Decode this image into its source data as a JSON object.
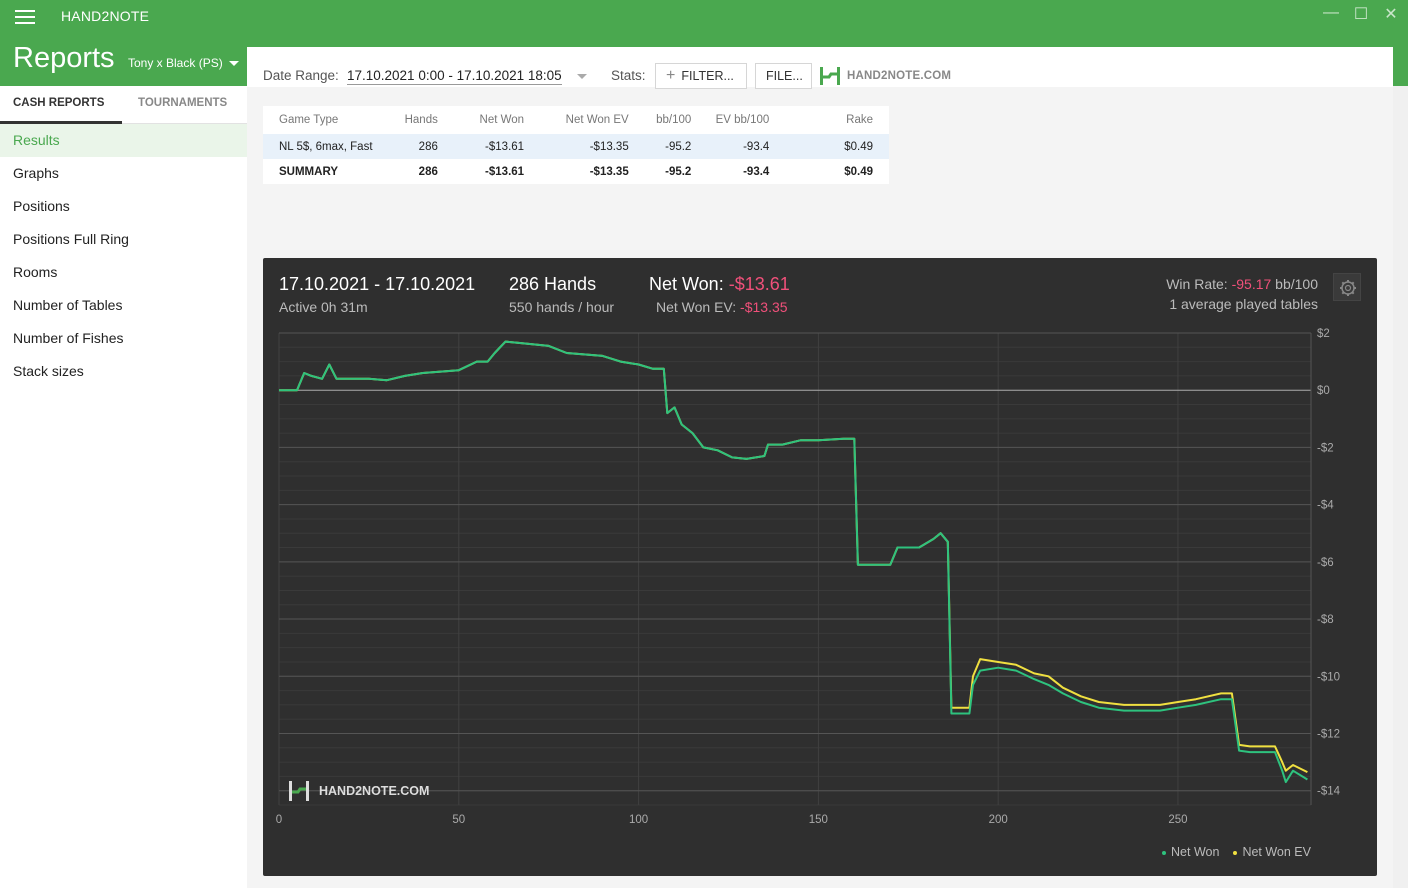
{
  "app": {
    "title": "HAND2NOTE",
    "window_controls": [
      "—",
      "☐",
      "✕"
    ]
  },
  "header": {
    "page_title": "Reports",
    "account": "Tony x Black (PS)"
  },
  "sidebar": {
    "tabs": [
      {
        "label": "CASH REPORTS",
        "active": true
      },
      {
        "label": "TOURNAMENTS",
        "active": false
      }
    ],
    "items": [
      {
        "label": "Results",
        "active": true
      },
      {
        "label": "Graphs",
        "active": false
      },
      {
        "label": "Positions",
        "active": false
      },
      {
        "label": "Positions Full Ring",
        "active": false
      },
      {
        "label": "Rooms",
        "active": false
      },
      {
        "label": "Number of Tables",
        "active": false
      },
      {
        "label": "Number of Fishes",
        "active": false
      },
      {
        "label": "Stack sizes",
        "active": false
      }
    ]
  },
  "toolbar": {
    "date_range_label": "Date Range:",
    "date_range_value": "17.10.2021 0:00 - 17.10.2021 18:05",
    "stats_label": "Stats:",
    "filter_label": "FILTER...",
    "file_label": "FILE...",
    "brand_text": "HAND2NOTE.COM"
  },
  "table": {
    "headers": [
      "Game Type",
      "Hands",
      "Net Won",
      "Net Won  EV",
      "bb/100",
      "EV bb/100",
      "Rake"
    ],
    "rows": [
      [
        "NL 5$, 6max, Fast",
        "286",
        "-$13.61",
        "-$13.35",
        "-95.2",
        "-93.4",
        "$0.49"
      ],
      [
        "SUMMARY",
        "286",
        "-$13.61",
        "-$13.35",
        "-95.2",
        "-93.4",
        "$0.49"
      ]
    ]
  },
  "chart_panel": {
    "date_range": "17.10.2021 - 17.10.2021",
    "active_time": "Active 0h 31m",
    "hands": "286 Hands",
    "hands_rate": "550 hands / hour",
    "net_won_label": "Net Won:",
    "net_won_value": "-$13.61",
    "net_won_ev_label": "Net Won  EV:",
    "net_won_ev_value": "-$13.35",
    "win_rate_label": "Win Rate:",
    "win_rate_value": "-95.17",
    "win_rate_unit": "bb/100",
    "avg_tables": "1 average played tables",
    "logo_text": "HAND2NOTE.COM"
  },
  "colors": {
    "accent": "#4aa84f",
    "net_won_line": "#2ec27e",
    "net_won_ev_line": "#f0e040",
    "negative": "#d9362b",
    "positive": "#3a9a3c",
    "pink": "#f0507a"
  },
  "chart_data": {
    "type": "line",
    "title": "",
    "xlabel": "",
    "ylabel": "",
    "xlim": [
      0,
      287
    ],
    "ylim": [
      -14.5,
      2
    ],
    "x_ticks": [
      0,
      50,
      100,
      150,
      200,
      250
    ],
    "y_ticks": [
      "$2",
      "$0",
      "-$2",
      "-$4",
      "-$6",
      "-$8",
      "-$10",
      "-$12",
      "-$14"
    ],
    "y_tick_values": [
      2,
      0,
      -2,
      -4,
      -6,
      -8,
      -10,
      -12,
      -14
    ],
    "grid": true,
    "legend": "bottom-right",
    "series": [
      {
        "name": "Net Won",
        "color": "#2ec27e",
        "points": [
          [
            0,
            0
          ],
          [
            5,
            0
          ],
          [
            7,
            0.6
          ],
          [
            9,
            0.5
          ],
          [
            12,
            0.4
          ],
          [
            14,
            0.9
          ],
          [
            16,
            0.4
          ],
          [
            25,
            0.4
          ],
          [
            30,
            0.35
          ],
          [
            35,
            0.5
          ],
          [
            40,
            0.6
          ],
          [
            50,
            0.7
          ],
          [
            55,
            1.0
          ],
          [
            58,
            1.0
          ],
          [
            60,
            1.3
          ],
          [
            63,
            1.7
          ],
          [
            67,
            1.65
          ],
          [
            75,
            1.55
          ],
          [
            80,
            1.3
          ],
          [
            90,
            1.2
          ],
          [
            95,
            1.0
          ],
          [
            100,
            0.9
          ],
          [
            104,
            0.75
          ],
          [
            107,
            0.75
          ],
          [
            108,
            -0.8
          ],
          [
            110,
            -0.6
          ],
          [
            112,
            -1.2
          ],
          [
            115,
            -1.5
          ],
          [
            118,
            -2.0
          ],
          [
            122,
            -2.1
          ],
          [
            126,
            -2.35
          ],
          [
            130,
            -2.4
          ],
          [
            135,
            -2.3
          ],
          [
            136,
            -1.9
          ],
          [
            140,
            -1.9
          ],
          [
            145,
            -1.75
          ],
          [
            150,
            -1.75
          ],
          [
            157,
            -1.7
          ],
          [
            160,
            -1.7
          ],
          [
            161,
            -6.1
          ],
          [
            165,
            -6.1
          ],
          [
            170,
            -6.1
          ],
          [
            172,
            -5.5
          ],
          [
            178,
            -5.5
          ],
          [
            182,
            -5.2
          ],
          [
            184,
            -5.0
          ],
          [
            186,
            -5.3
          ],
          [
            187,
            -11.3
          ],
          [
            192,
            -11.3
          ],
          [
            193,
            -10.3
          ],
          [
            195,
            -9.8
          ],
          [
            200,
            -9.7
          ],
          [
            205,
            -9.8
          ],
          [
            210,
            -10.1
          ],
          [
            214,
            -10.3
          ],
          [
            218,
            -10.6
          ],
          [
            223,
            -10.9
          ],
          [
            228,
            -11.1
          ],
          [
            235,
            -11.2
          ],
          [
            245,
            -11.2
          ],
          [
            250,
            -11.1
          ],
          [
            255,
            -11.0
          ],
          [
            262,
            -10.8
          ],
          [
            265,
            -10.8
          ],
          [
            267,
            -12.6
          ],
          [
            270,
            -12.65
          ],
          [
            277,
            -12.65
          ],
          [
            279,
            -13.3
          ],
          [
            280,
            -13.7
          ],
          [
            282,
            -13.3
          ],
          [
            286,
            -13.61
          ]
        ]
      },
      {
        "name": "Net Won  EV",
        "color": "#f0e040",
        "points": [
          [
            0,
            0
          ],
          [
            5,
            0
          ],
          [
            7,
            0.6
          ],
          [
            9,
            0.5
          ],
          [
            12,
            0.4
          ],
          [
            14,
            0.9
          ],
          [
            16,
            0.4
          ],
          [
            25,
            0.4
          ],
          [
            30,
            0.35
          ],
          [
            35,
            0.5
          ],
          [
            40,
            0.6
          ],
          [
            50,
            0.7
          ],
          [
            55,
            1.0
          ],
          [
            58,
            1.0
          ],
          [
            60,
            1.3
          ],
          [
            63,
            1.7
          ],
          [
            67,
            1.65
          ],
          [
            75,
            1.55
          ],
          [
            80,
            1.3
          ],
          [
            90,
            1.2
          ],
          [
            95,
            1.0
          ],
          [
            100,
            0.9
          ],
          [
            104,
            0.75
          ],
          [
            107,
            0.75
          ],
          [
            108,
            -0.8
          ],
          [
            110,
            -0.6
          ],
          [
            112,
            -1.2
          ],
          [
            115,
            -1.5
          ],
          [
            118,
            -2.0
          ],
          [
            122,
            -2.1
          ],
          [
            126,
            -2.35
          ],
          [
            130,
            -2.4
          ],
          [
            135,
            -2.3
          ],
          [
            136,
            -1.9
          ],
          [
            140,
            -1.9
          ],
          [
            145,
            -1.75
          ],
          [
            150,
            -1.75
          ],
          [
            157,
            -1.7
          ],
          [
            160,
            -1.7
          ],
          [
            161,
            -6.1
          ],
          [
            165,
            -6.1
          ],
          [
            170,
            -6.1
          ],
          [
            172,
            -5.5
          ],
          [
            178,
            -5.5
          ],
          [
            182,
            -5.2
          ],
          [
            184,
            -5.0
          ],
          [
            186,
            -5.3
          ],
          [
            187,
            -11.1
          ],
          [
            192,
            -11.1
          ],
          [
            193,
            -10.0
          ],
          [
            195,
            -9.4
          ],
          [
            200,
            -9.5
          ],
          [
            205,
            -9.6
          ],
          [
            210,
            -9.9
          ],
          [
            214,
            -10.0
          ],
          [
            218,
            -10.4
          ],
          [
            223,
            -10.7
          ],
          [
            228,
            -10.9
          ],
          [
            235,
            -11.0
          ],
          [
            245,
            -11.0
          ],
          [
            250,
            -10.9
          ],
          [
            255,
            -10.8
          ],
          [
            262,
            -10.6
          ],
          [
            265,
            -10.6
          ],
          [
            267,
            -12.4
          ],
          [
            270,
            -12.45
          ],
          [
            277,
            -12.45
          ],
          [
            279,
            -13.0
          ],
          [
            280,
            -13.3
          ],
          [
            282,
            -13.1
          ],
          [
            286,
            -13.35
          ]
        ]
      }
    ]
  }
}
